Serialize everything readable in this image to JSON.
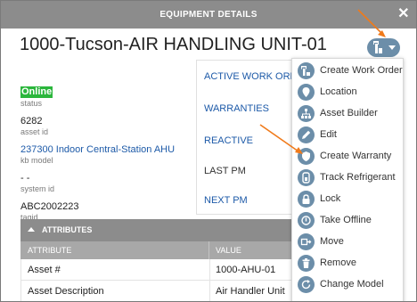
{
  "dialog": {
    "title": "EQUIPMENT DETAILS",
    "close_glyph": "✕",
    "asset_title": "1000-Tucson-AIR HANDLING UNIT-01"
  },
  "fields": {
    "status_value": "Online",
    "status_label": "status",
    "asset_id_value": "6282",
    "asset_id_label": "asset id",
    "kb_model_value": "237300 Indoor Central-Station AHU",
    "kb_model_label": "kb model",
    "system_id_value": "- -",
    "system_id_label": "system id",
    "tag_id_value": "ABC2002223",
    "tag_id_label": "tagid"
  },
  "mid_panel": {
    "items": [
      {
        "label": "ACTIVE WORK ORDERS"
      },
      {
        "label": "WARRANTIES"
      },
      {
        "label": "REACTIVE"
      },
      {
        "label": "LAST PM"
      },
      {
        "label": "NEXT PM"
      }
    ]
  },
  "attributes": {
    "heading": "ATTRIBUTES",
    "columns": [
      "ATTRIBUTE",
      "VALUE"
    ],
    "rows": [
      {
        "attribute": "Asset #",
        "value": "1000-AHU-01"
      },
      {
        "attribute": "Asset Description",
        "value": "Air Handler Unit"
      }
    ]
  },
  "action_menu": {
    "items": [
      {
        "label": "Create Work Order",
        "icon": "wrench-plus-icon"
      },
      {
        "label": "Location",
        "icon": "location-pin-icon"
      },
      {
        "label": "Asset Builder",
        "icon": "hierarchy-icon"
      },
      {
        "label": "Edit",
        "icon": "pencil-icon"
      },
      {
        "label": "Create Warranty",
        "icon": "shield-icon"
      },
      {
        "label": "Track Refrigerant",
        "icon": "refrigerant-icon"
      },
      {
        "label": "Lock",
        "icon": "lock-icon"
      },
      {
        "label": "Take Offline",
        "icon": "power-icon"
      },
      {
        "label": "Move",
        "icon": "move-icon"
      },
      {
        "label": "Remove",
        "icon": "trash-icon"
      },
      {
        "label": "Change Model",
        "icon": "refresh-icon"
      }
    ]
  },
  "colors": {
    "accent_blue": "#6c8ea9",
    "link_blue": "#1d5aa8",
    "online_green": "#2bb63c",
    "header_gray": "#8c8c8c",
    "annotation_arrow": "#f07a1a"
  }
}
